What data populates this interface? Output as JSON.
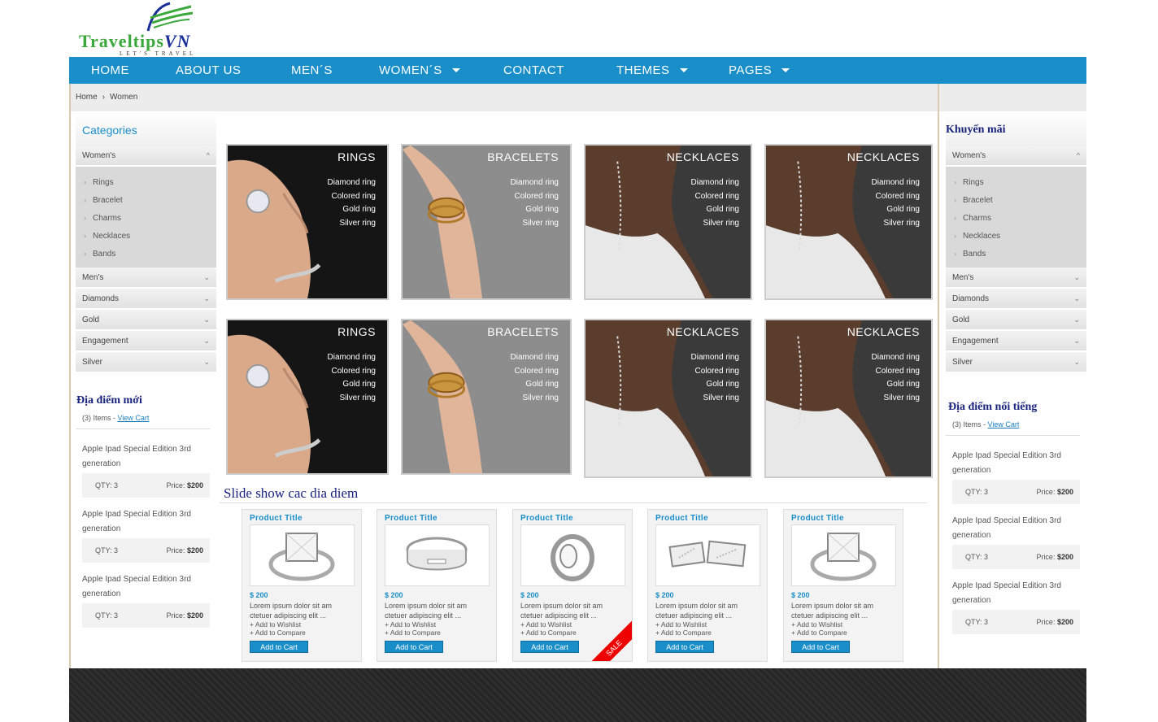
{
  "logo": {
    "brand_green": "Traveltips",
    "brand_blue": "VN",
    "tagline": "LET'S TRAVEL"
  },
  "nav": {
    "home": "HOME",
    "about": "ABOUT US",
    "mens": "MEN´S",
    "womens": "WOMEN´S",
    "contact": "CONTACT",
    "themes": "THEMES",
    "pages": "PAGES"
  },
  "breadcrumb": {
    "home": "Home",
    "current": "Women"
  },
  "left_sidebar": {
    "title": "Categories",
    "open_category": "Women's",
    "subitems": [
      "Rings",
      "Bracelet",
      "Charms",
      "Necklaces",
      "Bands"
    ],
    "categories": [
      "Men's",
      "Diamonds",
      "Gold",
      "Engagement",
      "Silver"
    ],
    "section_title": "Địa điểm mới"
  },
  "right_sidebar": {
    "title": "Khuyến mãi",
    "open_category": "Women's",
    "subitems": [
      "Rings",
      "Bracelet",
      "Charms",
      "Necklaces",
      "Bands"
    ],
    "categories": [
      "Men's",
      "Diamonds",
      "Gold",
      "Engagement",
      "Silver"
    ],
    "section_title": "Địa điểm nổi tiếng"
  },
  "cart": {
    "items_count": "(3) Items -",
    "view_cart": "View Cart",
    "product_name": "Apple Ipad Special Edition 3rd generation",
    "qty": "QTY: 3",
    "price_label": "Price:",
    "price": "$200"
  },
  "tiles": [
    {
      "title": "RINGS",
      "items": [
        "Diamond ring",
        "Colored ring",
        "Gold ring",
        "Silver ring"
      ]
    },
    {
      "title": "BRACELETS",
      "items": [
        "Diamond ring",
        "Colored ring",
        "Gold ring",
        "Silver ring"
      ]
    },
    {
      "title": "NECKLACES",
      "items": [
        "Diamond ring",
        "Colored ring",
        "Gold ring",
        "Silver ring"
      ]
    },
    {
      "title": "NECKLACES",
      "items": [
        "Diamond ring",
        "Colored ring",
        "Gold ring",
        "Silver ring"
      ]
    },
    {
      "title": "RINGS",
      "items": [
        "Diamond ring",
        "Colored ring",
        "Gold ring",
        "Silver ring"
      ]
    },
    {
      "title": "BRACELETS",
      "items": [
        "Diamond ring",
        "Colored ring",
        "Gold ring",
        "Silver ring"
      ]
    },
    {
      "title": "NECKLACES",
      "items": [
        "Diamond ring",
        "Colored ring",
        "Gold ring",
        "Silver ring"
      ]
    },
    {
      "title": "NECKLACES",
      "items": [
        "Diamond ring",
        "Colored ring",
        "Gold ring",
        "Silver ring"
      ]
    }
  ],
  "slideshow": {
    "title": "Slide show cac dia diem",
    "product": {
      "title": "Product Title",
      "price": "$ 200",
      "desc": "Lorem ipsum dolor sit am ctetuer adipiscing elit ...",
      "wishlist": "+ Add to Wishlist",
      "compare": "+ Add to Compare",
      "add_to_cart": "Add to Cart"
    },
    "sale_label": "SALE"
  },
  "colors": {
    "nav": "#1a8ec9",
    "heading": "#1a237e",
    "link": "#1a7ec0"
  }
}
